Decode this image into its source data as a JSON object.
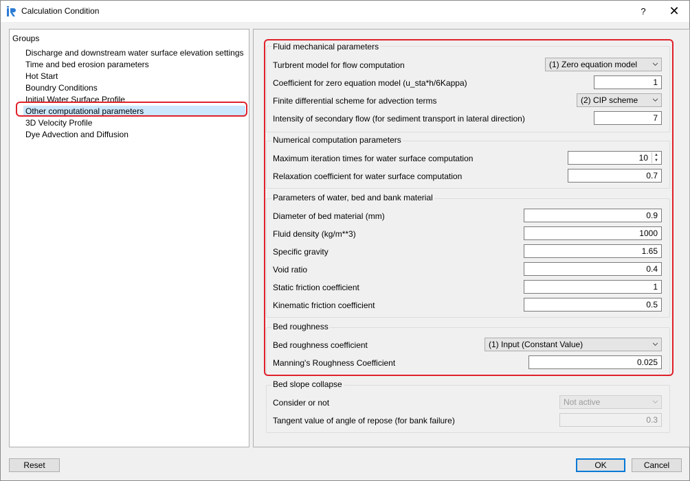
{
  "window": {
    "title": "Calculation Condition",
    "help": "?",
    "close": "✕"
  },
  "groups": {
    "title": "Groups",
    "items": [
      "Discharge and downstream water surface elevation settings",
      "Time and bed erosion parameters",
      "Hot Start",
      "Boundry Conditions",
      "Initial Water Surface Profile",
      "Other computational parameters",
      "3D Velocity Profile",
      "Dye Advection and Diffusion"
    ],
    "selected_index": 5
  },
  "fluid": {
    "title": "Fluid mechanical parameters",
    "turbulent_label": "Turbrent model for flow computation",
    "turbulent_value": "(1) Zero equation model",
    "coef_label": "Coefficient for zero equation model (u_sta*h/6Kappa)",
    "coef_value": "1",
    "scheme_label": "Finite differential scheme for advection terms",
    "scheme_value": "(2) CIP scheme",
    "secondary_label": "Intensity of secondary flow (for sediment transport in lateral direction)",
    "secondary_value": "7"
  },
  "numerical": {
    "title": "Numerical computation parameters",
    "iter_label": "Maximum iteration times for water surface computation",
    "iter_value": "10",
    "relax_label": "Relaxation coefficient for water surface computation",
    "relax_value": "0.7"
  },
  "material": {
    "title": "Parameters of water, bed and bank material",
    "diameter_label": "Diameter of bed material (mm)",
    "diameter_value": "0.9",
    "density_label": "Fluid density (kg/m**3)",
    "density_value": "1000",
    "gravity_label": "Specific gravity",
    "gravity_value": "1.65",
    "void_label": "Void ratio",
    "void_value": "0.4",
    "static_label": "Static friction coefficient",
    "static_value": "1",
    "kinematic_label": "Kinematic friction coefficient",
    "kinematic_value": "0.5"
  },
  "roughness": {
    "title": "Bed roughness",
    "coef_label": "Bed roughness coefficient",
    "coef_value": "(1) Input (Constant Value)",
    "manning_label": "Manning's Roughness Coefficient",
    "manning_value": "0.025"
  },
  "slope": {
    "title": "Bed slope collapse",
    "consider_label": "Consider or not",
    "consider_value": "Not active",
    "tangent_label": "Tangent value of angle of repose (for bank failure)",
    "tangent_value": "0.3"
  },
  "footer": {
    "reset": "Reset",
    "ok": "OK",
    "cancel": "Cancel"
  },
  "colors": {
    "highlight": "#e0202a",
    "selection": "#cce8ff",
    "accent": "#0078d7"
  },
  "icons": {
    "app": "iric-app-icon",
    "dropdown": "chevron-down-icon",
    "spin": "spin-arrows-icon"
  }
}
